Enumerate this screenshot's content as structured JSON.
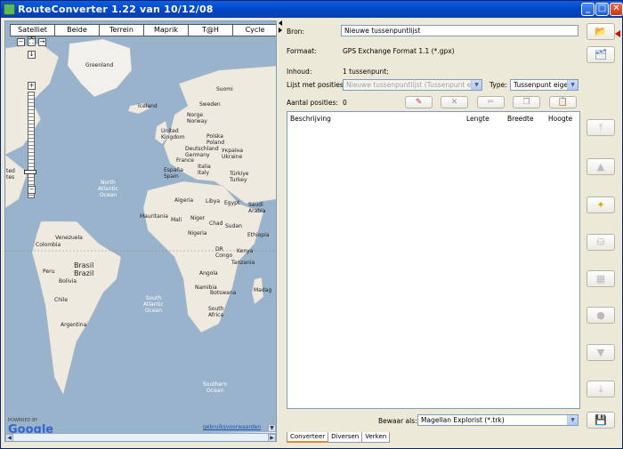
{
  "window": {
    "title": "RouteConverter 1.22 van 10/12/08"
  },
  "map": {
    "tabs": [
      "Satelliet",
      "Beide",
      "Terrein",
      "Maprik",
      "T@H",
      "Cycle"
    ],
    "labels": {
      "greenland": "Greenland",
      "iceland": "Iceland",
      "sweden": "Sweden",
      "suomi": "Suomi",
      "norge": "Norge\nNorway",
      "united_kingdom": "United\nKingdom",
      "polska": "Polska\nPoland",
      "deutschland": "Deutschland\nGermany",
      "ukraine": "Україна\nUkraine",
      "france": "France",
      "italia": "Italia\nItaly",
      "espana": "España\nSpain",
      "turkiye": "Türkiye\nTurkey",
      "algeria": "Algeria",
      "libya": "Libya",
      "egypt": "Egypt",
      "saudi": "Saudi\nArabia",
      "mauritania": "Mauritania",
      "mali": "Mali",
      "niger": "Niger",
      "chad": "Chad",
      "sudan": "Sudan",
      "nigeria": "Nigeria",
      "ethiopia": "Ethiopia",
      "venezuela": "Venezuela",
      "colombia": "Colombia",
      "dr_congo": "DR\nCongo",
      "kenya": "Kenya",
      "tanzania": "Tanzania",
      "peru": "Peru",
      "brasil": "Brasil\nBrazil",
      "bolivia": "Bolivia",
      "angola": "Angola",
      "namibia": "Namibia",
      "botswana": "Botswana",
      "madag": "Madag",
      "chile": "Chile",
      "south_africa": "South\nAfrica",
      "argentina": "Argentina",
      "united_states_part": "ted\ntes"
    },
    "oceans": {
      "north_atlantic": "North\nAtlantic\nOcean",
      "south_atlantic": "South\nAtlantic\nOcean",
      "southern": "Southern\nOcean"
    },
    "google": {
      "powered_by": "POWERED BY",
      "logo": "Google"
    },
    "terms_link": "gebruiksvoorwaarden"
  },
  "form": {
    "bron_label": "Bron:",
    "bron_value": "Nieuwe tussenpuntlijst",
    "formaat_label": "Formaat:",
    "formaat_value": "GPS Exchange Format 1.1 (*.gpx)",
    "inhoud_label": "Inhoud:",
    "inhoud_value": "1 tussenpunt;",
    "lijst_label": "Lijst met posities:",
    "lijst_value": "Nieuwe tussenpuntlijst (Tussenpunt eigen)",
    "type_label": "Type:",
    "type_value": "Tussenpunt eigen",
    "aantal_label": "Aantal posities:",
    "aantal_value": "0",
    "table_headers": [
      "Beschrijving",
      "Lengte",
      "Breedte",
      "Hoogte"
    ],
    "bewaar_label": "Bewaar als:",
    "bewaar_value": "Magellan Explorist (*.trk)",
    "bottom_tabs": [
      "Converteer",
      "Diversen",
      "Verken"
    ]
  },
  "icons": {
    "open": "folder-open-icon",
    "append": "append-icon",
    "edit": "pencil-icon",
    "delete": "x-icon",
    "cut": "scissors-icon",
    "copy": "copy-icon",
    "paste": "clipboard-icon",
    "top": "move-top-icon",
    "up": "move-up-icon",
    "new_position": "new-position-icon",
    "dummy1": "cylinder-icon",
    "dummy2": "table-icon",
    "dummy3": "circle-icon",
    "down": "move-down-icon",
    "bottom": "move-bottom-icon",
    "save": "save-icon"
  },
  "colors": {
    "title_bar": "#0047c8",
    "ocean": "#99b3cc",
    "land": "#eeeae0",
    "accent_tab": "#e68b2c"
  }
}
